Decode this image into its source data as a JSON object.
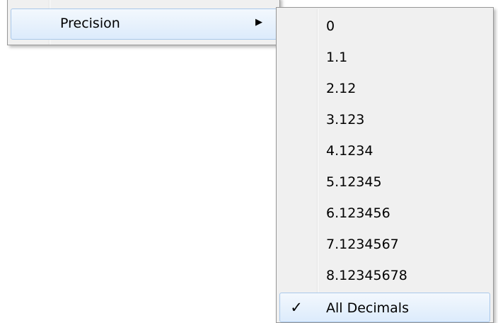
{
  "parent_menu": {
    "item_label": "Precision",
    "arrow_icon": "chevron-right-icon"
  },
  "submenu": {
    "items": [
      {
        "label": "0"
      },
      {
        "label": "1.1"
      },
      {
        "label": "2.12"
      },
      {
        "label": "3.123"
      },
      {
        "label": "4.1234"
      },
      {
        "label": "5.12345"
      },
      {
        "label": "6.123456"
      },
      {
        "label": "7.1234567"
      },
      {
        "label": "8.12345678"
      },
      {
        "label": "All Decimals",
        "checked": true
      }
    ],
    "check_icon": "checkmark-icon"
  },
  "colors": {
    "menu_bg": "#f0f0f0",
    "hover_border": "#a9c8ea",
    "hover_bg_top": "#f3f8fd",
    "hover_bg_bottom": "#dcebfc"
  }
}
